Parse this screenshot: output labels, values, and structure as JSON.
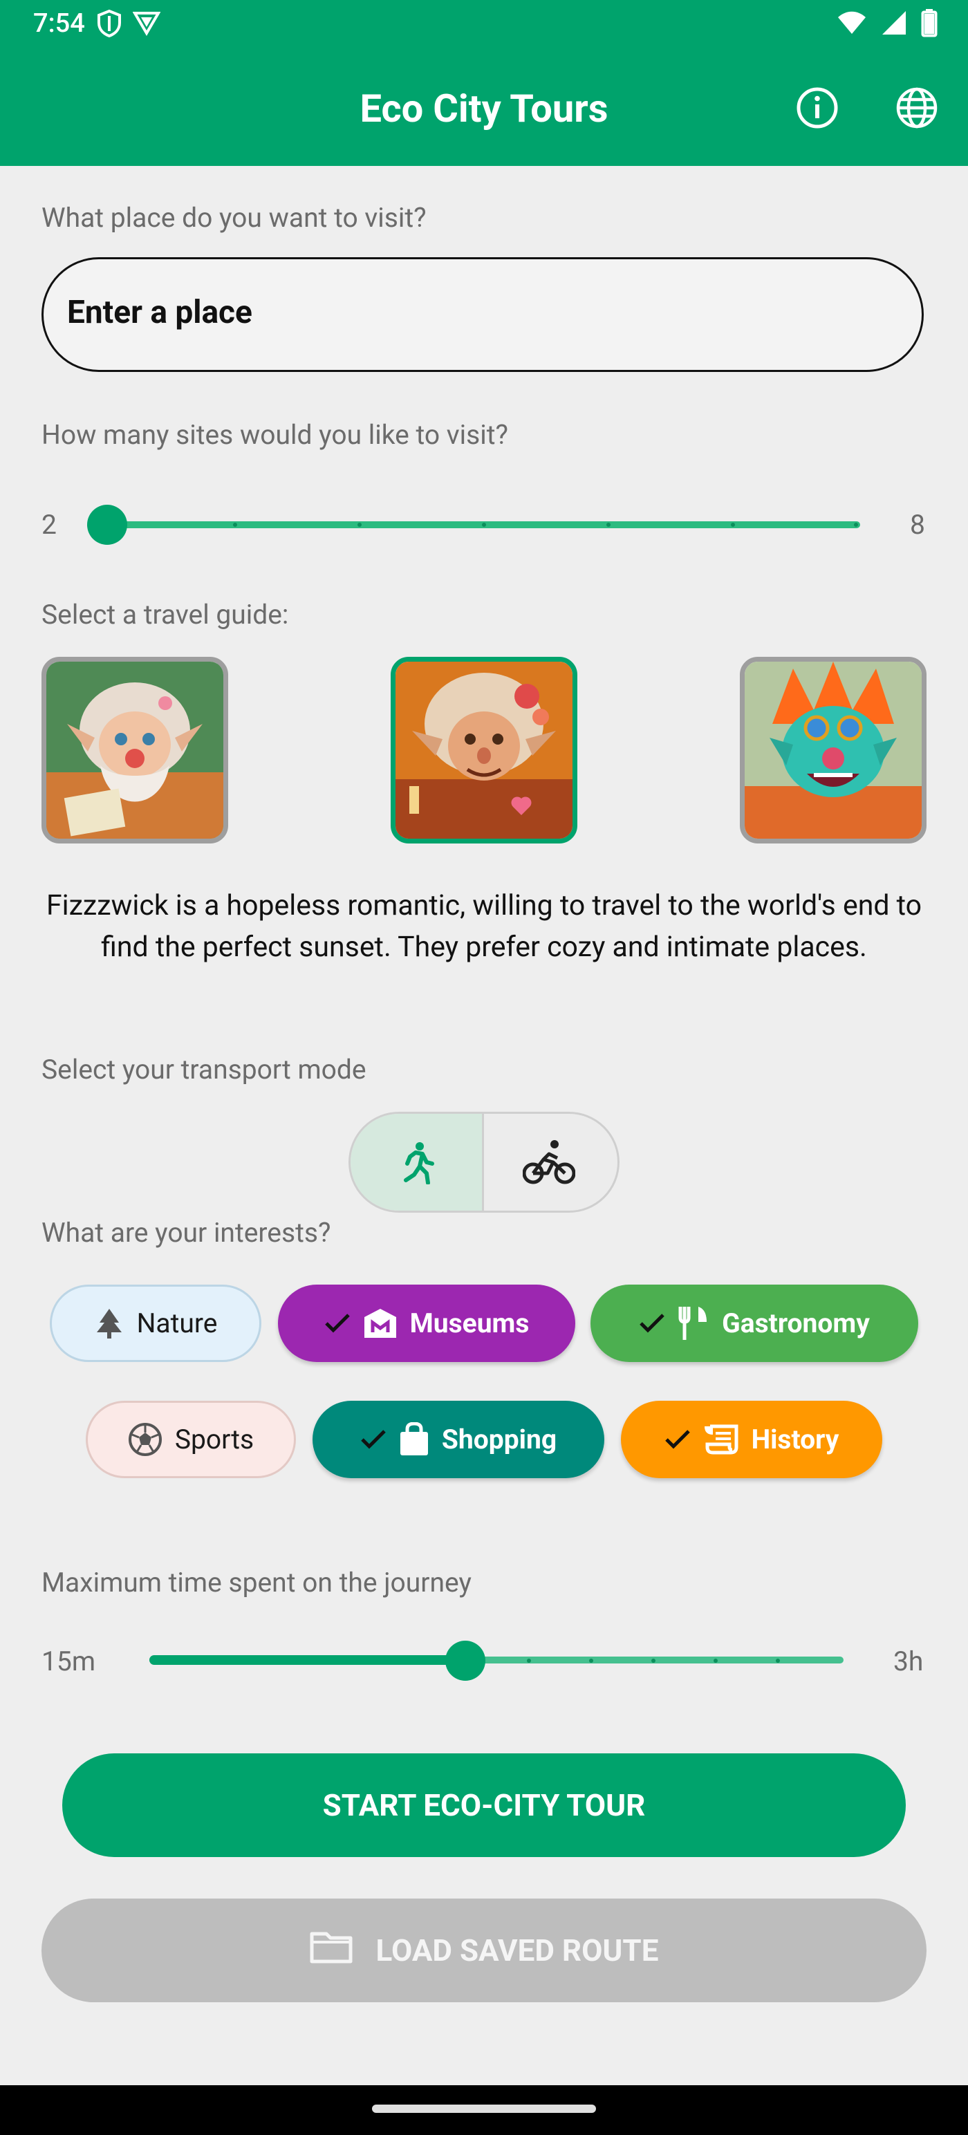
{
  "status_bar": {
    "time": "7:54",
    "icons_left": [
      "shield-icon",
      "vpn-triangle-icon"
    ],
    "icons_right": [
      "wifi-icon",
      "signal-icon",
      "battery-icon"
    ]
  },
  "app_bar": {
    "title": "Eco City Tours",
    "icons": [
      "info-icon",
      "globe-icon"
    ],
    "color": "#00a36c"
  },
  "place": {
    "label": "What place do you want to visit?",
    "placeholder": "Enter a place"
  },
  "sites": {
    "label": "How many sites would you like to visit?",
    "min_label": "2",
    "max_label": "8",
    "value": 2,
    "min": 2,
    "max": 8
  },
  "guide": {
    "label": "Select a travel guide:",
    "options": [
      {
        "name": "guide-bearded-troll",
        "selected": false
      },
      {
        "name": "guide-fizzzwick",
        "selected": true
      },
      {
        "name": "guide-punk-troll",
        "selected": false
      }
    ],
    "description": "Fizzzwick is a hopeless romantic, willing to travel to the world's end to find the perfect sunset. They prefer cozy and intimate places."
  },
  "transport": {
    "label": "Select your transport mode",
    "options": [
      {
        "icon": "walk-icon",
        "selected": true
      },
      {
        "icon": "bike-icon",
        "selected": false
      }
    ]
  },
  "interests": {
    "label": "What are your interests?",
    "chips": [
      {
        "label": "Nature",
        "icon": "tree-icon",
        "selected": false,
        "color": "#e3f1fb"
      },
      {
        "label": "Museums",
        "icon": "museum-icon",
        "selected": true,
        "color": "#9c27b0"
      },
      {
        "label": "Gastronomy",
        "icon": "fork-knife-icon",
        "selected": true,
        "color": "#4caf50"
      },
      {
        "label": "Sports",
        "icon": "soccer-ball-icon",
        "selected": false,
        "color": "#fbe9e7"
      },
      {
        "label": "Shopping",
        "icon": "shopping-bag-icon",
        "selected": true,
        "color": "#00897b"
      },
      {
        "label": "History",
        "icon": "scroll-icon",
        "selected": true,
        "color": "#ff9800"
      }
    ]
  },
  "time": {
    "label": "Maximum time spent on the journey",
    "min_label": "15m",
    "max_label": "3h",
    "fraction": 0.455
  },
  "buttons": {
    "start": "START ECO-CITY TOUR",
    "load": "LOAD SAVED ROUTE"
  }
}
